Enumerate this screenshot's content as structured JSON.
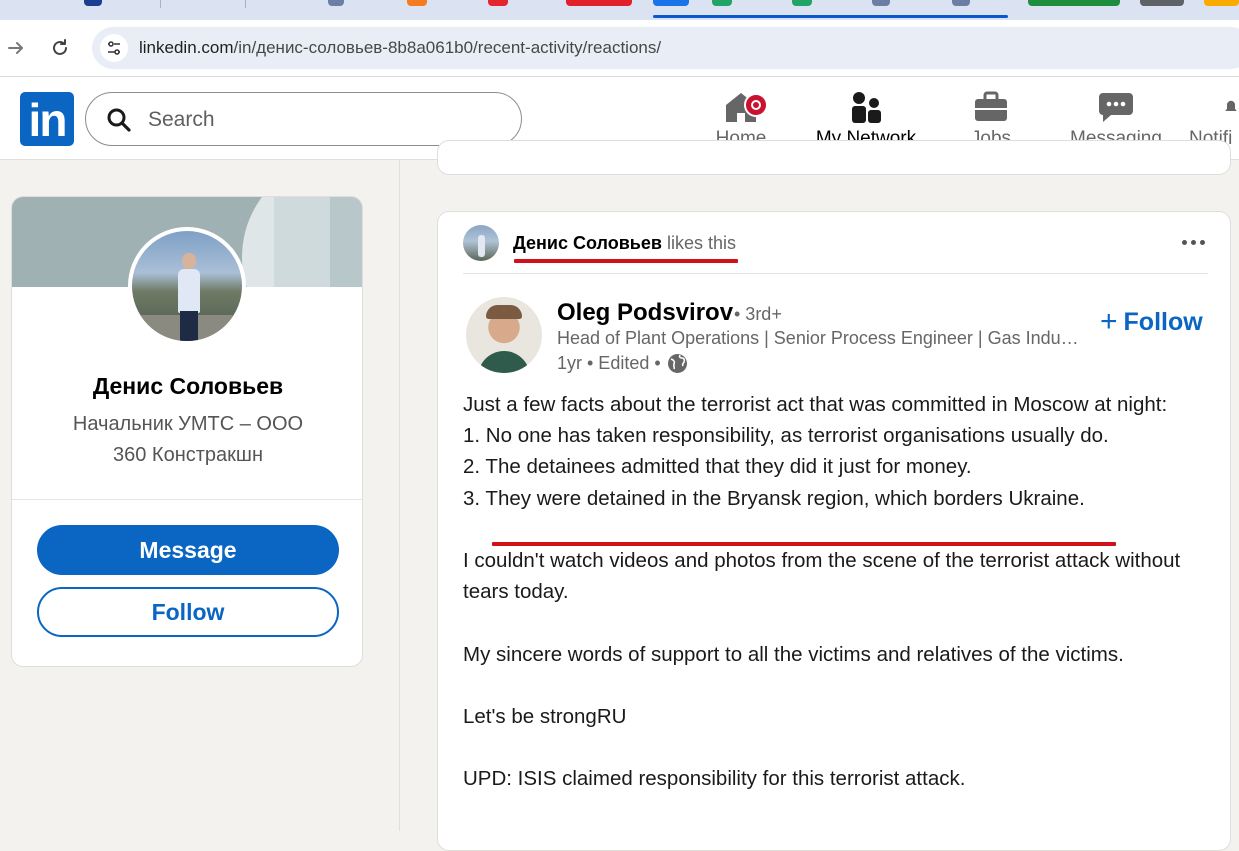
{
  "browser": {
    "url_host": "linkedin.com",
    "url_path": "/in/денис-соловьев-8b8a061b0/recent-activity/reactions/"
  },
  "header": {
    "search_placeholder": "Search",
    "nav": [
      {
        "label": "Home",
        "icon": "home-icon"
      },
      {
        "label": "My Network",
        "icon": "people-icon"
      },
      {
        "label": "Jobs",
        "icon": "briefcase-icon"
      },
      {
        "label": "Messaging",
        "icon": "chat-icon"
      },
      {
        "label": "Notifi",
        "icon": "bell-icon"
      }
    ]
  },
  "profile": {
    "name": "Денис Соловьев",
    "headline_line1": "Начальник УМТС – ООО",
    "headline_line2": "360 Констракшн",
    "message_label": "Message",
    "follow_label": "Follow"
  },
  "post": {
    "context_who": "Денис Соловьев",
    "context_what": " likes this",
    "author_name": "Oleg Podsvirov",
    "author_degree": "• 3rd+",
    "author_headline": "Head of Plant Operations | Senior Process Engineer | Gas Industry",
    "author_time": "1yr • Edited •",
    "follow_label": "Follow",
    "body": [
      "Just a few facts about the terrorist act that was committed in Moscow at night:",
      "1. No one has taken responsibility, as terrorist organisations usually do.",
      "2. The detainees admitted that they did it just for money.",
      "3. They were detained in the Bryansk region, which borders Ukraine.",
      "",
      "I couldn't watch videos and photos from the scene of the terrorist attack without tears today.",
      "",
      "My sincere words of support to all the victims and relatives of the victims.",
      "",
      "Let's be strongRU",
      "",
      "UPD: ISIS claimed responsibility for this terrorist attack."
    ]
  },
  "colors": {
    "linkedin_blue": "#0a66c2",
    "annotation_red": "#d0101a",
    "notification_red": "#cb112d"
  }
}
